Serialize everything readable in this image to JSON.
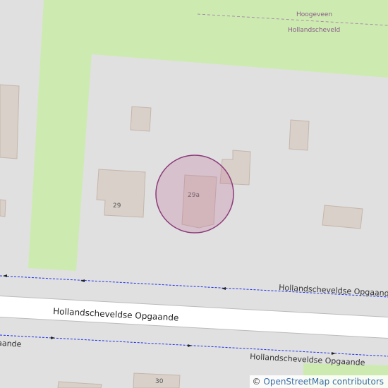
{
  "map": {
    "colors": {
      "background": "#e0e0e0",
      "water": "#aad3df",
      "grass": "#cdebb0",
      "building": "#d9d0c9",
      "building_stroke": "#c4b6ab",
      "road": "#ffffff",
      "road_casing": "#bbbbbb",
      "path": "#1e2ee8",
      "boundary": "#a78ca8",
      "marker_fill": "#c27ba0",
      "marker_stroke": "#8b3a7a"
    },
    "labels": {
      "place_hoogeveen": "Hoogeveen",
      "place_hollandscheveld": "Hollandscheveld",
      "road_main": "Hollandscheveldse Opgaande",
      "path_north": "Hollandscheveldse Opgaande",
      "path_south": "Hollandscheveldse Opgaande",
      "path_south_left": "aande"
    },
    "house_numbers": {
      "h29": "29",
      "h29a": "29a",
      "h30": "30"
    }
  },
  "attribution": {
    "prefix": "©",
    "text": "OpenStreetMap contributors"
  }
}
